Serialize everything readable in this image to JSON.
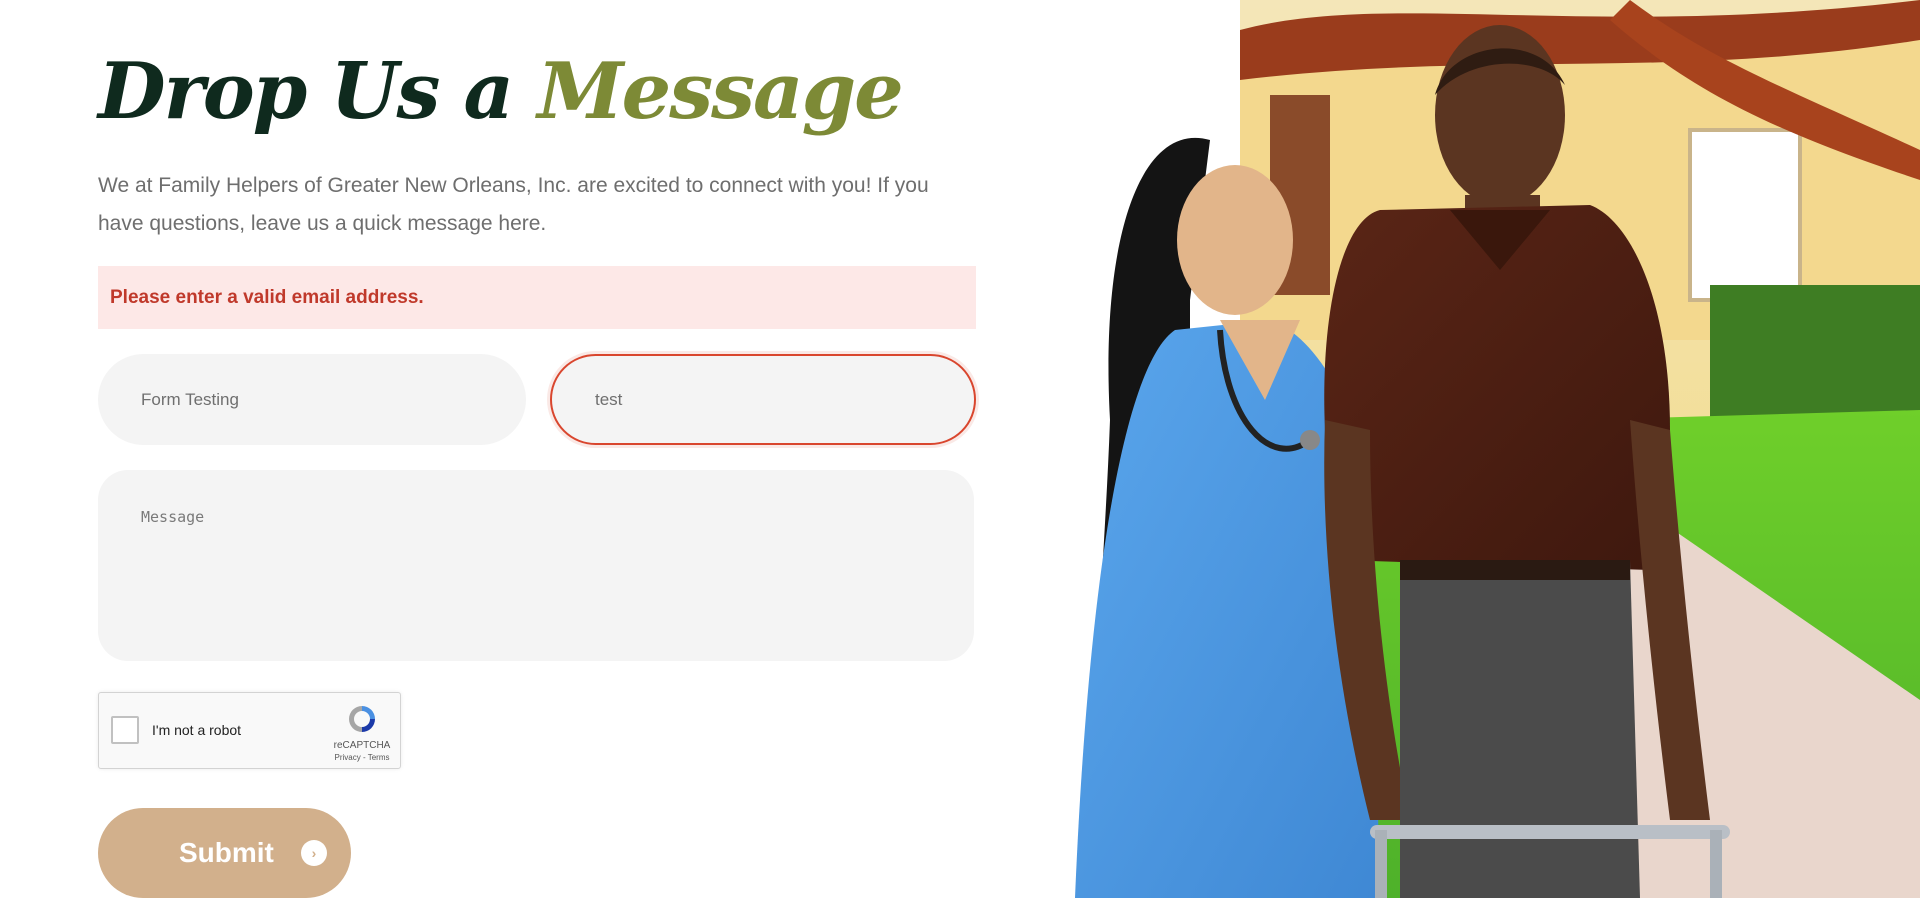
{
  "heading": {
    "part1": "Drop Us a",
    "part2": "Message"
  },
  "intro": "We at Family Helpers of Greater New Orleans, Inc. are excited to connect with you! If you have questions, leave us a quick message here.",
  "alert": {
    "text": "Please enter a valid email address."
  },
  "form": {
    "name_value": "Form Testing",
    "email_value": "test",
    "message_placeholder": "Message"
  },
  "captcha": {
    "label": "I'm not a robot",
    "brand": "reCAPTCHA",
    "links": "Privacy - Terms"
  },
  "submit": {
    "label": "Submit",
    "icon": "chevron-right-icon"
  },
  "colors": {
    "heading_dark": "#0f2a1e",
    "heading_accent": "#7d8a36",
    "alert_bg": "#fde8e7",
    "alert_text": "#c0392b",
    "error_border": "#d9462e",
    "submit_bg": "#d2b08c"
  }
}
